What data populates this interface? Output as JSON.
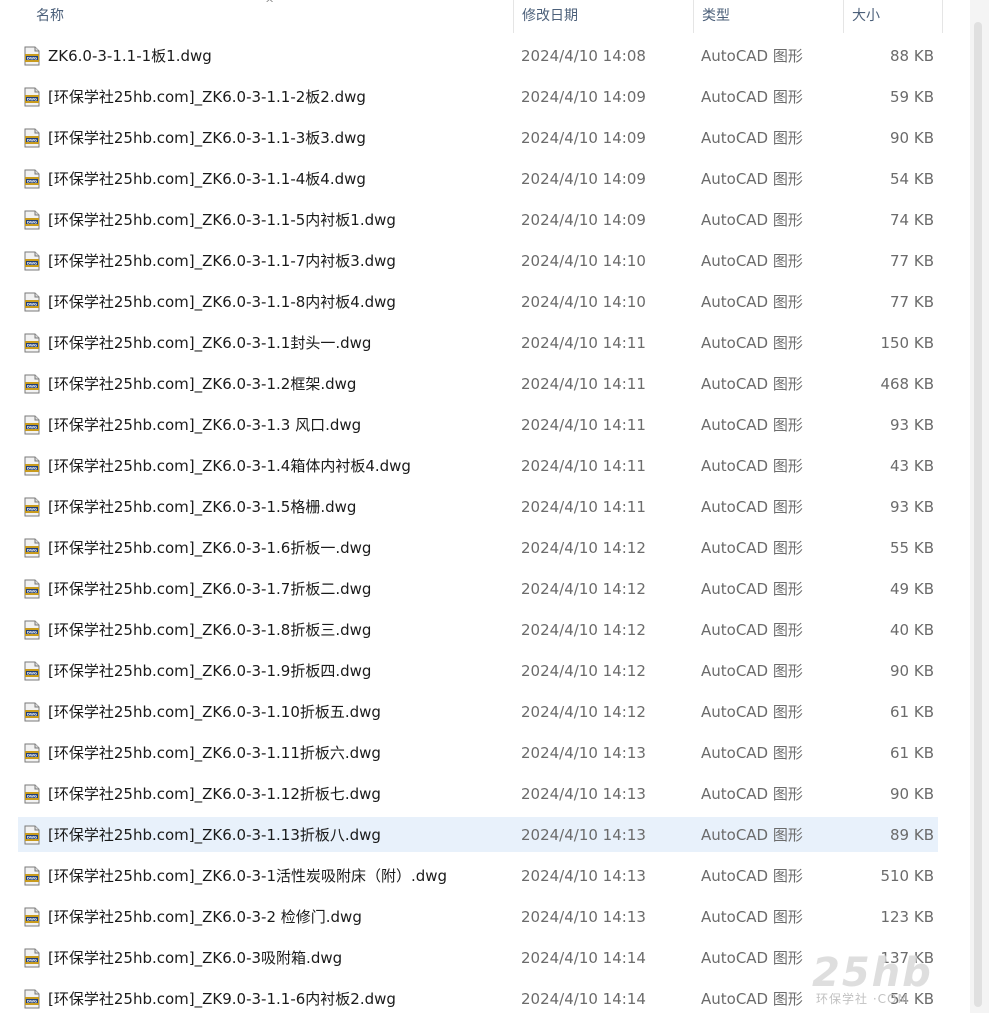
{
  "columns": {
    "name": "名称",
    "modified": "修改日期",
    "type": "类型",
    "size": "大小"
  },
  "sort_indicator": "^",
  "icon": "dwg-file-icon",
  "files": [
    {
      "name": "ZK6.0-3-1.1-1板1.dwg",
      "modified": "2024/4/10 14:08",
      "type": "AutoCAD 图形",
      "size": "88 KB"
    },
    {
      "name": "[环保学社25hb.com]_ZK6.0-3-1.1-2板2.dwg",
      "modified": "2024/4/10 14:09",
      "type": "AutoCAD 图形",
      "size": "59 KB"
    },
    {
      "name": "[环保学社25hb.com]_ZK6.0-3-1.1-3板3.dwg",
      "modified": "2024/4/10 14:09",
      "type": "AutoCAD 图形",
      "size": "90 KB"
    },
    {
      "name": "[环保学社25hb.com]_ZK6.0-3-1.1-4板4.dwg",
      "modified": "2024/4/10 14:09",
      "type": "AutoCAD 图形",
      "size": "54 KB"
    },
    {
      "name": "[环保学社25hb.com]_ZK6.0-3-1.1-5内衬板1.dwg",
      "modified": "2024/4/10 14:09",
      "type": "AutoCAD 图形",
      "size": "74 KB"
    },
    {
      "name": "[环保学社25hb.com]_ZK6.0-3-1.1-7内衬板3.dwg",
      "modified": "2024/4/10 14:10",
      "type": "AutoCAD 图形",
      "size": "77 KB"
    },
    {
      "name": "[环保学社25hb.com]_ZK6.0-3-1.1-8内衬板4.dwg",
      "modified": "2024/4/10 14:10",
      "type": "AutoCAD 图形",
      "size": "77 KB"
    },
    {
      "name": "[环保学社25hb.com]_ZK6.0-3-1.1封头一.dwg",
      "modified": "2024/4/10 14:11",
      "type": "AutoCAD 图形",
      "size": "150 KB"
    },
    {
      "name": "[环保学社25hb.com]_ZK6.0-3-1.2框架.dwg",
      "modified": "2024/4/10 14:11",
      "type": "AutoCAD 图形",
      "size": "468 KB"
    },
    {
      "name": "[环保学社25hb.com]_ZK6.0-3-1.3 风口.dwg",
      "modified": "2024/4/10 14:11",
      "type": "AutoCAD 图形",
      "size": "93 KB"
    },
    {
      "name": "[环保学社25hb.com]_ZK6.0-3-1.4箱体内衬板4.dwg",
      "modified": "2024/4/10 14:11",
      "type": "AutoCAD 图形",
      "size": "43 KB"
    },
    {
      "name": "[环保学社25hb.com]_ZK6.0-3-1.5格栅.dwg",
      "modified": "2024/4/10 14:11",
      "type": "AutoCAD 图形",
      "size": "93 KB"
    },
    {
      "name": "[环保学社25hb.com]_ZK6.0-3-1.6折板一.dwg",
      "modified": "2024/4/10 14:12",
      "type": "AutoCAD 图形",
      "size": "55 KB"
    },
    {
      "name": "[环保学社25hb.com]_ZK6.0-3-1.7折板二.dwg",
      "modified": "2024/4/10 14:12",
      "type": "AutoCAD 图形",
      "size": "49 KB"
    },
    {
      "name": "[环保学社25hb.com]_ZK6.0-3-1.8折板三.dwg",
      "modified": "2024/4/10 14:12",
      "type": "AutoCAD 图形",
      "size": "40 KB"
    },
    {
      "name": "[环保学社25hb.com]_ZK6.0-3-1.9折板四.dwg",
      "modified": "2024/4/10 14:12",
      "type": "AutoCAD 图形",
      "size": "90 KB"
    },
    {
      "name": "[环保学社25hb.com]_ZK6.0-3-1.10折板五.dwg",
      "modified": "2024/4/10 14:12",
      "type": "AutoCAD 图形",
      "size": "61 KB"
    },
    {
      "name": "[环保学社25hb.com]_ZK6.0-3-1.11折板六.dwg",
      "modified": "2024/4/10 14:13",
      "type": "AutoCAD 图形",
      "size": "61 KB"
    },
    {
      "name": "[环保学社25hb.com]_ZK6.0-3-1.12折板七.dwg",
      "modified": "2024/4/10 14:13",
      "type": "AutoCAD 图形",
      "size": "90 KB"
    },
    {
      "name": "[环保学社25hb.com]_ZK6.0-3-1.13折板八.dwg",
      "modified": "2024/4/10 14:13",
      "type": "AutoCAD 图形",
      "size": "89 KB",
      "selected": true
    },
    {
      "name": "[环保学社25hb.com]_ZK6.0-3-1活性炭吸附床（附）.dwg",
      "modified": "2024/4/10 14:13",
      "type": "AutoCAD 图形",
      "size": "510 KB"
    },
    {
      "name": "[环保学社25hb.com]_ZK6.0-3-2 检修门.dwg",
      "modified": "2024/4/10 14:13",
      "type": "AutoCAD 图形",
      "size": "123 KB"
    },
    {
      "name": "[环保学社25hb.com]_ZK6.0-3吸附箱.dwg",
      "modified": "2024/4/10 14:14",
      "type": "AutoCAD 图形",
      "size": "137 KB"
    },
    {
      "name": "[环保学社25hb.com]_ZK9.0-3-1.1-6内衬板2.dwg",
      "modified": "2024/4/10 14:14",
      "type": "AutoCAD 图形",
      "size": "54 KB"
    }
  ],
  "watermark": {
    "logo": "25hb",
    "tagline": "环保学社 ·COM"
  },
  "colors": {
    "header_text": "#4c607a",
    "selected_row": "#e8f1fb",
    "secondary_text": "#6b6b6b"
  }
}
